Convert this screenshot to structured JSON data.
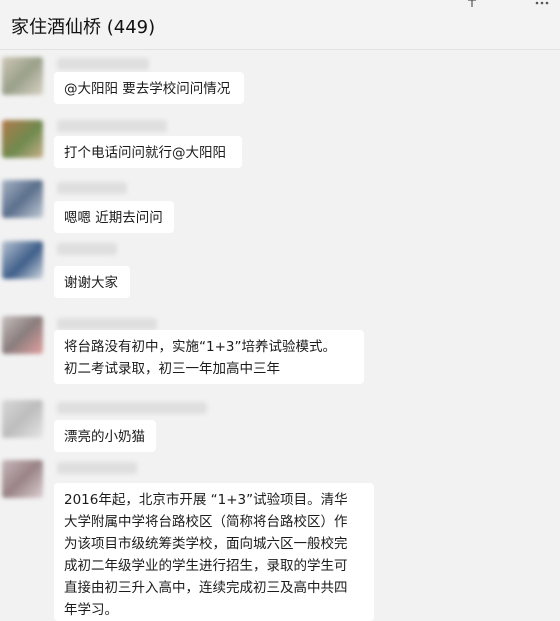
{
  "header": {
    "title": "家住酒仙桥 (449)"
  },
  "messages": [
    {
      "text": "@大阳阳 要去学校问问情况"
    },
    {
      "text": "打个电话问问就行@大阳阳"
    },
    {
      "text": "嗯嗯 近期去问问"
    },
    {
      "text": "谢谢大家"
    },
    {
      "lines": [
        "将台路没有初中，实施“1+3”培养试验模式。",
        "初二考试录取，初三一年加高中三年"
      ]
    },
    {
      "text": "漂亮的小奶猫"
    },
    {
      "lines": [
        "2016年起，北京市开展 “1+3”试验项目。清华",
        "大学附属中学将台路校区（简称将台路校区）作",
        "为该项目市级统筹类学校，面向城六区一般校完",
        "成初二年级学业的学生进行招生，录取的学生可",
        "直接由初三升入高中，连续完成初三及高中共四",
        "年学习。"
      ]
    }
  ],
  "colors": {
    "background": "#f2f2f2",
    "bubble": "#ffffff",
    "text": "#1b1b1b"
  }
}
